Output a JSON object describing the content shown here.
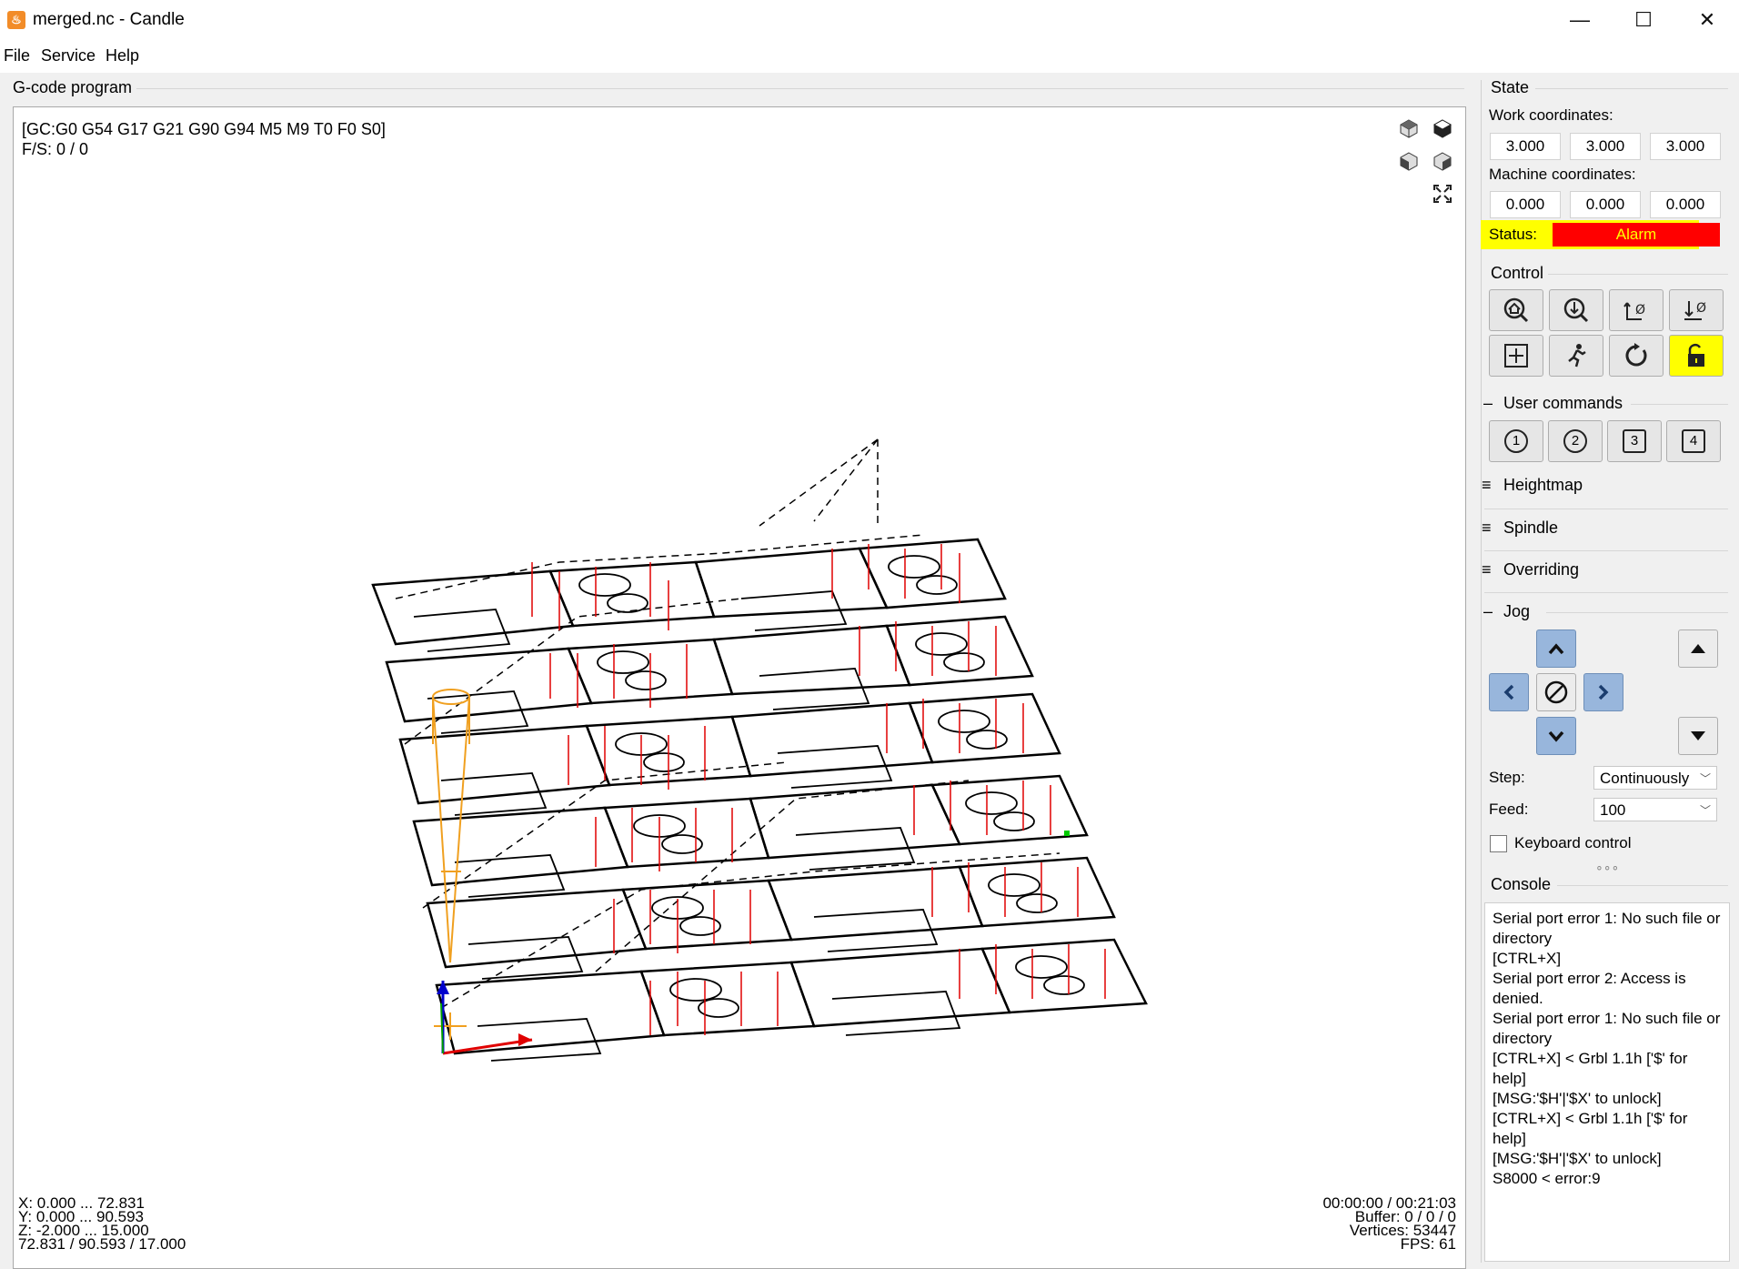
{
  "window": {
    "title": "merged.nc - Candle",
    "minimize": "—",
    "maximize": "☐",
    "close": "✕",
    "icon": "candle-flame-icon"
  },
  "menu": [
    "File",
    "Service",
    "Help"
  ],
  "gcode_panel": {
    "title": "G-code program",
    "gc_line": "[GC:G0 G54 G17 G21 G90 G94 M5 M9 T0 F0 S0]",
    "fs_line": "F/S: 0 / 0",
    "bounds": [
      "X: 0.000 ... 72.831",
      "Y: 0.000 ... 90.593",
      "Z: -2.000 ... 15.000",
      "72.831 / 90.593 / 17.000"
    ],
    "stats": [
      "00:00:00 / 00:21:03",
      "Buffer: 0 / 0 / 0",
      "Vertices: 53447",
      "FPS: 61"
    ]
  },
  "state": {
    "title": "State",
    "work_label": "Work coordinates:",
    "work": [
      "3.000",
      "3.000",
      "3.000"
    ],
    "machine_label": "Machine coordinates:",
    "machine": [
      "0.000",
      "0.000",
      "0.000"
    ],
    "status_label": "Status:",
    "status_value": "Alarm",
    "status_color": "#ff0000",
    "highlight_color": "#ffff00"
  },
  "control": {
    "title": "Control",
    "buttons": [
      "home-icon",
      "probe-icon",
      "zero-xy-icon",
      "zero-z-icon",
      "restore-origin-icon",
      "safe-position-icon",
      "reset-icon",
      "unlock-icon"
    ]
  },
  "user_commands": {
    "title": "User commands",
    "buttons": [
      "1",
      "2",
      "3",
      "4"
    ]
  },
  "collapsed": [
    "Heightmap",
    "Spindle",
    "Overriding"
  ],
  "jog": {
    "title": "Jog",
    "step_label": "Step:",
    "step_value": "Continuously",
    "feed_label": "Feed:",
    "feed_value": "100",
    "keyboard_label": "Keyboard control",
    "keyboard_checked": false
  },
  "console": {
    "title": "Console",
    "lines": [
      "Serial port error 1: No such file or directory",
      "[CTRL+X]",
      "Serial port error 2: Access is denied.",
      "Serial port error 1: No such file or directory",
      "[CTRL+X] < Grbl 1.1h ['$' for help]",
      "[MSG:'$H'|'$X' to unlock]",
      "[CTRL+X] < Grbl 1.1h ['$' for help]",
      "[MSG:'$H'|'$X' to unlock]",
      "S8000 < error:9"
    ]
  }
}
